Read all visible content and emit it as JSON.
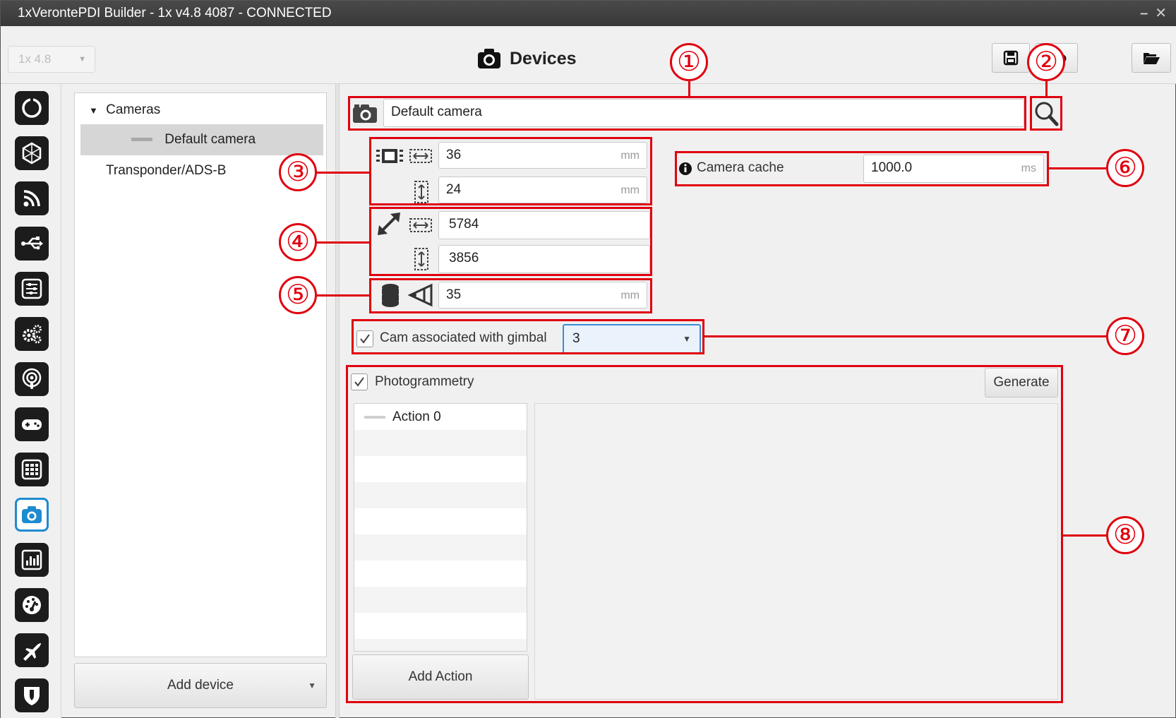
{
  "window": {
    "title": "1xVerontePDI Builder - 1x v4.8 4087 - CONNECTED"
  },
  "header": {
    "version": "1x 4.8",
    "title": "Devices",
    "buttons": [
      "save-icon",
      "cloud-download-icon",
      "folder-open-icon"
    ]
  },
  "sidebar": {
    "icons": [
      "status-icon",
      "network-icon",
      "feed-icon",
      "usb-icon",
      "sliders-icon",
      "gears-icon",
      "podcast-icon",
      "gamepad-icon",
      "grid-icon",
      "camera-icon",
      "chart-icon",
      "gauge-icon",
      "plane-icon",
      "shield-icon"
    ],
    "active": "camera-icon"
  },
  "tree": {
    "group": "Cameras",
    "selected_item": "Default camera",
    "other_item": "Transponder/ADS-B"
  },
  "add_device_label": "Add device",
  "camera": {
    "name": "Default camera",
    "sensor_width": "36",
    "sensor_height": "24",
    "sensor_unit": "mm",
    "res_width": "5784",
    "res_height": "3856",
    "focal_length": "35",
    "focal_unit": "mm",
    "cache_label": "Camera cache",
    "cache_value": "1000.0",
    "cache_unit": "ms",
    "gimbal_label": "Cam associated with gimbal",
    "gimbal_checked": true,
    "gimbal_value": "3"
  },
  "photogrammetry": {
    "label": "Photogrammetry",
    "checked": true,
    "generate_label": "Generate",
    "actions": [
      "Action 0"
    ],
    "add_action_label": "Add Action"
  },
  "callouts": [
    "①",
    "②",
    "③",
    "④",
    "⑤",
    "⑥",
    "⑦",
    "⑧"
  ],
  "colors": {
    "annotation": "#e0000f",
    "accent": "#1e8bd0"
  }
}
